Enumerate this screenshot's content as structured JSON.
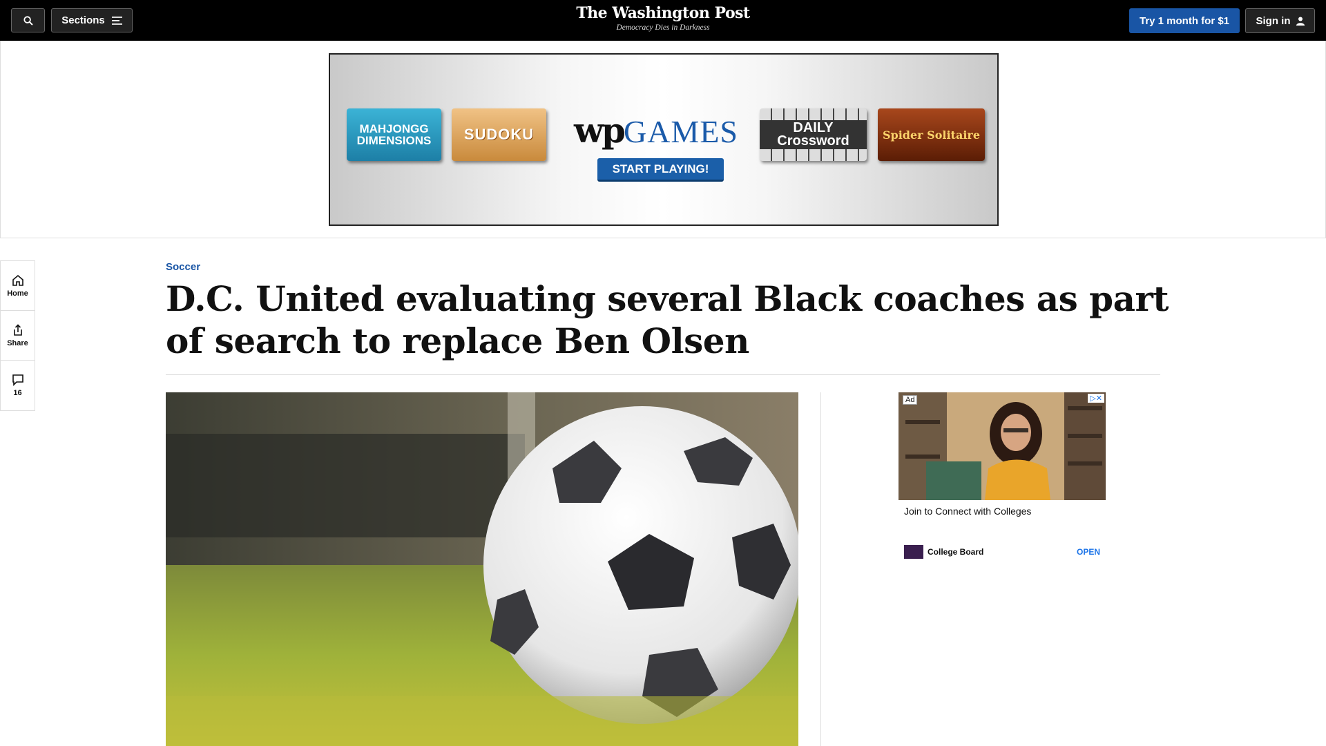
{
  "header": {
    "sections_label": "Sections",
    "logo": "The Washington Post",
    "tagline": "Democracy Dies in Darkness",
    "try_label": "Try 1 month for $1",
    "signin_label": "Sign in",
    "colors": {
      "background": "#000000",
      "cta": "#1955a5"
    }
  },
  "banner_ad": {
    "tiles": [
      "MAHJONGG DIMENSIONS",
      "SUDOKU",
      "DAILY Crossword",
      "Spider Solitaire"
    ],
    "brand_wp": "wp",
    "brand_games": "GAMES",
    "cta": "START PLAYING!"
  },
  "rail": {
    "home": "Home",
    "share": "Share",
    "comments_count": "16"
  },
  "article": {
    "kicker": "Soccer",
    "headline": "D.C. United evaluating several Black coaches as part of search to replace Ben Olsen"
  },
  "side_ad": {
    "label": "Ad",
    "close": "▷✕",
    "cta": "Join to Connect with Colleges",
    "brand": "College Board",
    "open_label": "OPEN"
  }
}
